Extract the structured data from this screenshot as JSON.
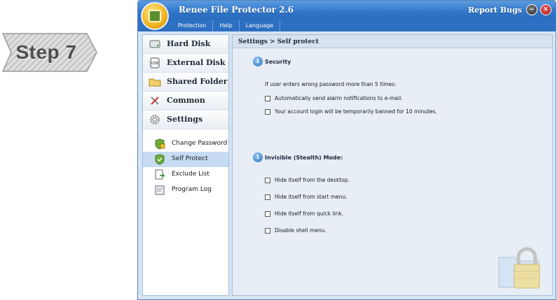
{
  "step_badge": {
    "label": "Step 7"
  },
  "window": {
    "title": "Renee File Protector 2.6",
    "report_bugs": "Report Bugs",
    "minimize_glyph": "−",
    "close_glyph": "✕"
  },
  "menu": [
    "Protection",
    "Help",
    "Language"
  ],
  "sidebar": {
    "items": [
      {
        "label": "Hard Disk",
        "icon": "hard-disk-icon"
      },
      {
        "label": "External Disk",
        "icon": "usb-disk-icon"
      },
      {
        "label": "Shared Folder",
        "icon": "folder-icon"
      },
      {
        "label": "Common",
        "icon": "tools-icon"
      },
      {
        "label": "Settings",
        "icon": "gear-icon"
      }
    ],
    "sub_items": [
      {
        "label": "Change Password",
        "icon": "key-shield-icon",
        "active": false
      },
      {
        "label": "Self Protect",
        "icon": "shield-icon",
        "active": true
      },
      {
        "label": "Exclude List",
        "icon": "exclude-list-icon",
        "active": false
      },
      {
        "label": "Program Log",
        "icon": "log-icon",
        "active": false
      }
    ]
  },
  "content": {
    "breadcrumb": "Settings > Self protect",
    "security": {
      "icon_glyph": "i",
      "title": "Security",
      "description": "If user enters wrong password more than 5 times:",
      "options": [
        "Automatically send alarm notifications to e-mail.",
        "Your account login will be temporarily banned for 10 minutes."
      ]
    },
    "stealth": {
      "icon_glyph": "i",
      "title": "Invisible (Stealth) Mode:",
      "options": [
        "Hide itself from the desktop.",
        "Hide itself from start menu.",
        "Hide itself from quick link.",
        "Disable shell menu."
      ]
    }
  },
  "colors": {
    "titlebar": "#2f74c8",
    "active_item": "#c7dcf3",
    "content_bg": "#e8eef5"
  }
}
